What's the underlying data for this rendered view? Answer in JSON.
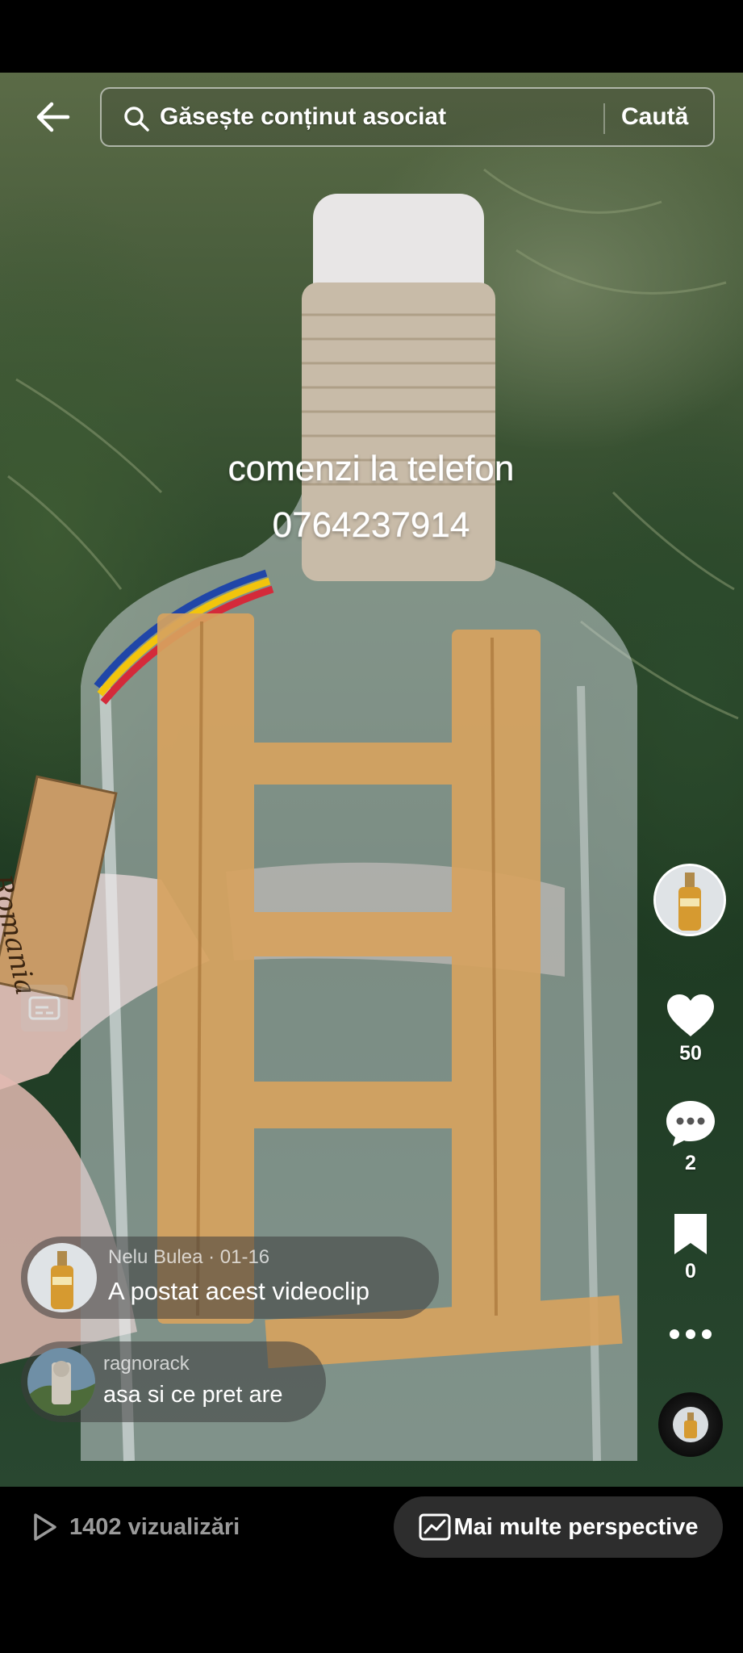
{
  "search": {
    "placeholder": "Găsește conținut asociat",
    "submit_label": "Caută"
  },
  "video": {
    "overlay_lines": [
      "comenzi la telefon",
      "0764237914"
    ],
    "label_text": "Romania"
  },
  "actions": {
    "likes": "50",
    "comments": "2",
    "saves": "0"
  },
  "comments": [
    {
      "author": "Nelu Bulea",
      "date": "01-16",
      "separator": " · ",
      "text": "A postat acest videoclip"
    },
    {
      "author": "ragnorack",
      "text": "asa si ce pret are"
    }
  ],
  "bottom": {
    "views_label": "1402 vizualizări",
    "insights_label": "Mai multe perspective"
  },
  "icons": [
    "back-arrow-icon",
    "search-icon",
    "captions-icon",
    "heart-icon",
    "comment-icon",
    "bookmark-icon",
    "more-icon",
    "play-icon",
    "insights-chart-icon"
  ]
}
